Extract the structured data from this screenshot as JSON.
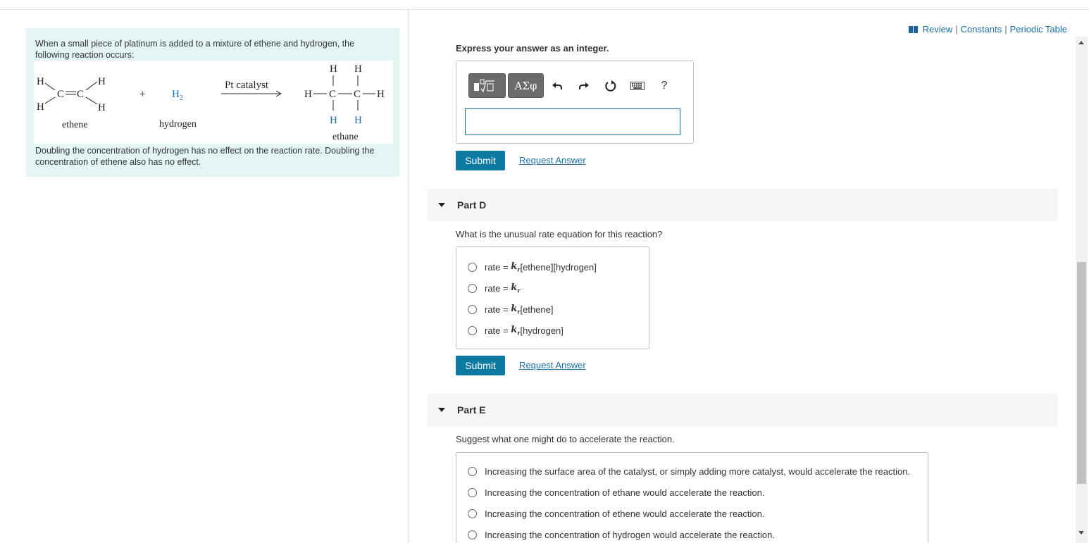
{
  "toplinks": {
    "review": "Review",
    "constants": "Constants",
    "periodic_table": "Periodic Table",
    "separator": "|"
  },
  "intro": {
    "top_text": "When a small piece of platinum is added to a mixture of ethene and hydrogen, the following reaction occurs:",
    "bottom_text": "Doubling the concentration of hydrogen has no effect on the reaction rate. Doubling the concentration of ethene also has no effect.",
    "reaction": {
      "h": "H",
      "c": "C",
      "plus": "+",
      "h2": "H",
      "h2_subscript": "2",
      "catalyst": "Pt catalyst",
      "ethene_label": "ethene",
      "hydrogen_label": "hydrogen",
      "ethane_label": "ethane"
    }
  },
  "part_c": {
    "instruction": "Express your answer as an integer.",
    "greek_label": "ΑΣφ",
    "help_label": "?",
    "input_value": "",
    "submit_label": "Submit",
    "request_label": "Request Answer"
  },
  "part_d": {
    "title": "Part D",
    "question": "What is the unusual rate equation for this reaction?",
    "options": [
      {
        "prefix": "rate = ",
        "k": "k",
        "k_sub": "r",
        "suffix": "[ethene][hydrogen]"
      },
      {
        "prefix": "rate = ",
        "k": "k",
        "k_sub": "r",
        "suffix": ""
      },
      {
        "prefix": "rate = ",
        "k": "k",
        "k_sub": "r",
        "suffix": "[ethene]"
      },
      {
        "prefix": "rate = ",
        "k": "k",
        "k_sub": "r",
        "suffix": "[hydrogen]"
      }
    ],
    "submit_label": "Submit",
    "request_label": "Request Answer"
  },
  "part_e": {
    "title": "Part E",
    "question": "Suggest what one might do to accelerate the reaction.",
    "options": [
      "Increasing the surface area of the catalyst, or simply adding more catalyst, would accelerate the reaction.",
      "Increasing the concentration of ethane would accelerate the reaction.",
      "Increasing the concentration of ethene would accelerate the reaction.",
      "Increasing the concentration of hydrogen would accelerate the reaction."
    ]
  },
  "colors": {
    "accent": "#0e7aa1",
    "link": "#1b6fa8",
    "intro_bg": "#e4f5f6",
    "part_header_bg": "#f5f5f5"
  },
  "icons": [
    "book-icon",
    "template-icon",
    "greek-symbols-icon",
    "undo-icon",
    "redo-icon",
    "reset-icon",
    "keyboard-icon",
    "help-icon",
    "collapse-triangle-icon",
    "radio-icon"
  ]
}
